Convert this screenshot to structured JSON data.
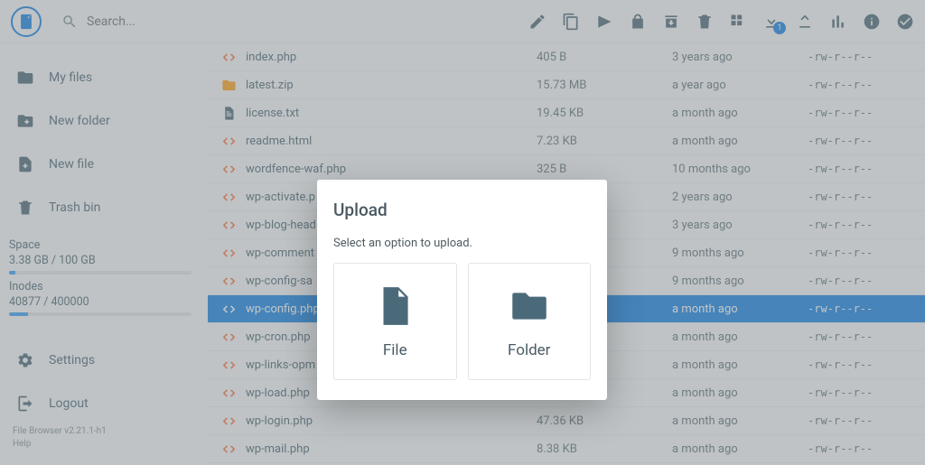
{
  "header": {
    "search_placeholder": "Search...",
    "download_badge": "1"
  },
  "sidebar": {
    "items": [
      {
        "label": "My files"
      },
      {
        "label": "New folder"
      },
      {
        "label": "New file"
      },
      {
        "label": "Trash bin"
      },
      {
        "label": "Settings"
      },
      {
        "label": "Logout"
      }
    ],
    "space_label": "Space",
    "space_value": "3.38 GB / 100 GB",
    "space_pct": 3.4,
    "inodes_label": "Inodes",
    "inodes_value": "40877 / 400000",
    "inodes_pct": 10.2,
    "version": "File Browser v2.21.1-h1",
    "help": "Help"
  },
  "files": [
    {
      "icon": "code",
      "name": "index.php",
      "size": "405 B",
      "time": "3 years ago",
      "perm": "-rw-r--r--",
      "sel": false
    },
    {
      "icon": "zip",
      "name": "latest.zip",
      "size": "15.73 MB",
      "time": "a year ago",
      "perm": "-rw-r--r--",
      "sel": false
    },
    {
      "icon": "txt",
      "name": "license.txt",
      "size": "19.45 KB",
      "time": "a month ago",
      "perm": "-rw-r--r--",
      "sel": false
    },
    {
      "icon": "code",
      "name": "readme.html",
      "size": "7.23 KB",
      "time": "a month ago",
      "perm": "-rw-r--r--",
      "sel": false
    },
    {
      "icon": "code",
      "name": "wordfence-waf.php",
      "size": "325 B",
      "time": "10 months ago",
      "perm": "-rw-r--r--",
      "sel": false
    },
    {
      "icon": "code",
      "name": "wp-activate.p",
      "size": "",
      "time": "2 years ago",
      "perm": "-rw-r--r--",
      "sel": false
    },
    {
      "icon": "code",
      "name": "wp-blog-head",
      "size": "",
      "time": "3 years ago",
      "perm": "-rw-r--r--",
      "sel": false
    },
    {
      "icon": "code",
      "name": "wp-comment",
      "size": "",
      "time": "9 months ago",
      "perm": "-rw-r--r--",
      "sel": false
    },
    {
      "icon": "code",
      "name": "wp-config-sa",
      "size": "",
      "time": "9 months ago",
      "perm": "-rw-r--r--",
      "sel": false
    },
    {
      "icon": "code",
      "name": "wp-config.php",
      "size": "",
      "time": "a month ago",
      "perm": "-rw-r--r--",
      "sel": true
    },
    {
      "icon": "code",
      "name": "wp-cron.php",
      "size": "",
      "time": "a month ago",
      "perm": "-rw-r--r--",
      "sel": false
    },
    {
      "icon": "code",
      "name": "wp-links-opm",
      "size": "",
      "time": "a month ago",
      "perm": "-rw-r--r--",
      "sel": false
    },
    {
      "icon": "code",
      "name": "wp-load.php",
      "size": "",
      "time": "a month ago",
      "perm": "-rw-r--r--",
      "sel": false
    },
    {
      "icon": "code",
      "name": "wp-login.php",
      "size": "47.36 KB",
      "time": "a month ago",
      "perm": "-rw-r--r--",
      "sel": false
    },
    {
      "icon": "code",
      "name": "wp-mail.php",
      "size": "8.38 KB",
      "time": "a month ago",
      "perm": "-rw-r--r--",
      "sel": false
    }
  ],
  "dialog": {
    "title": "Upload",
    "prompt": "Select an option to upload.",
    "file_label": "File",
    "folder_label": "Folder"
  }
}
